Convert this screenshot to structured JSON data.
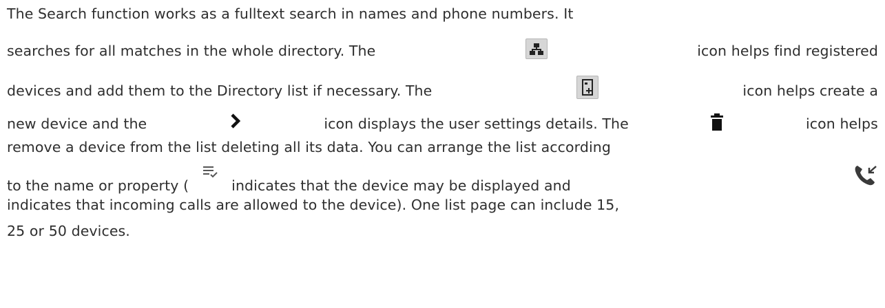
{
  "paragraph": {
    "l1": "The Search function works as a fulltext search in names and phone numbers. It",
    "l2a": "searches for all matches in the whole directory. The",
    "l2b": "icon helps find registered",
    "l3a": "devices and add them to the Directory list if necessary. The",
    "l3b": "icon helps create a",
    "l4a": "new device and the",
    "l4b": "icon displays the user settings details. The",
    "l4c": "icon helps",
    "l5": "remove a device from the list deleting all its data. You can arrange the list according",
    "l6a": "to the name or property (",
    "l6b": "indicates that the device may be displayed and",
    "l7": "indicates that incoming calls are allowed to the device). One list page can include 15,",
    "l8": "25 or 50 devices."
  },
  "icons": {
    "registered_devices": "registered-devices-icon",
    "add_device": "add-device-icon",
    "details": "chevron-right-icon",
    "delete": "trash-icon",
    "display": "sort-check-icon",
    "incoming_calls": "incoming-call-icon"
  }
}
